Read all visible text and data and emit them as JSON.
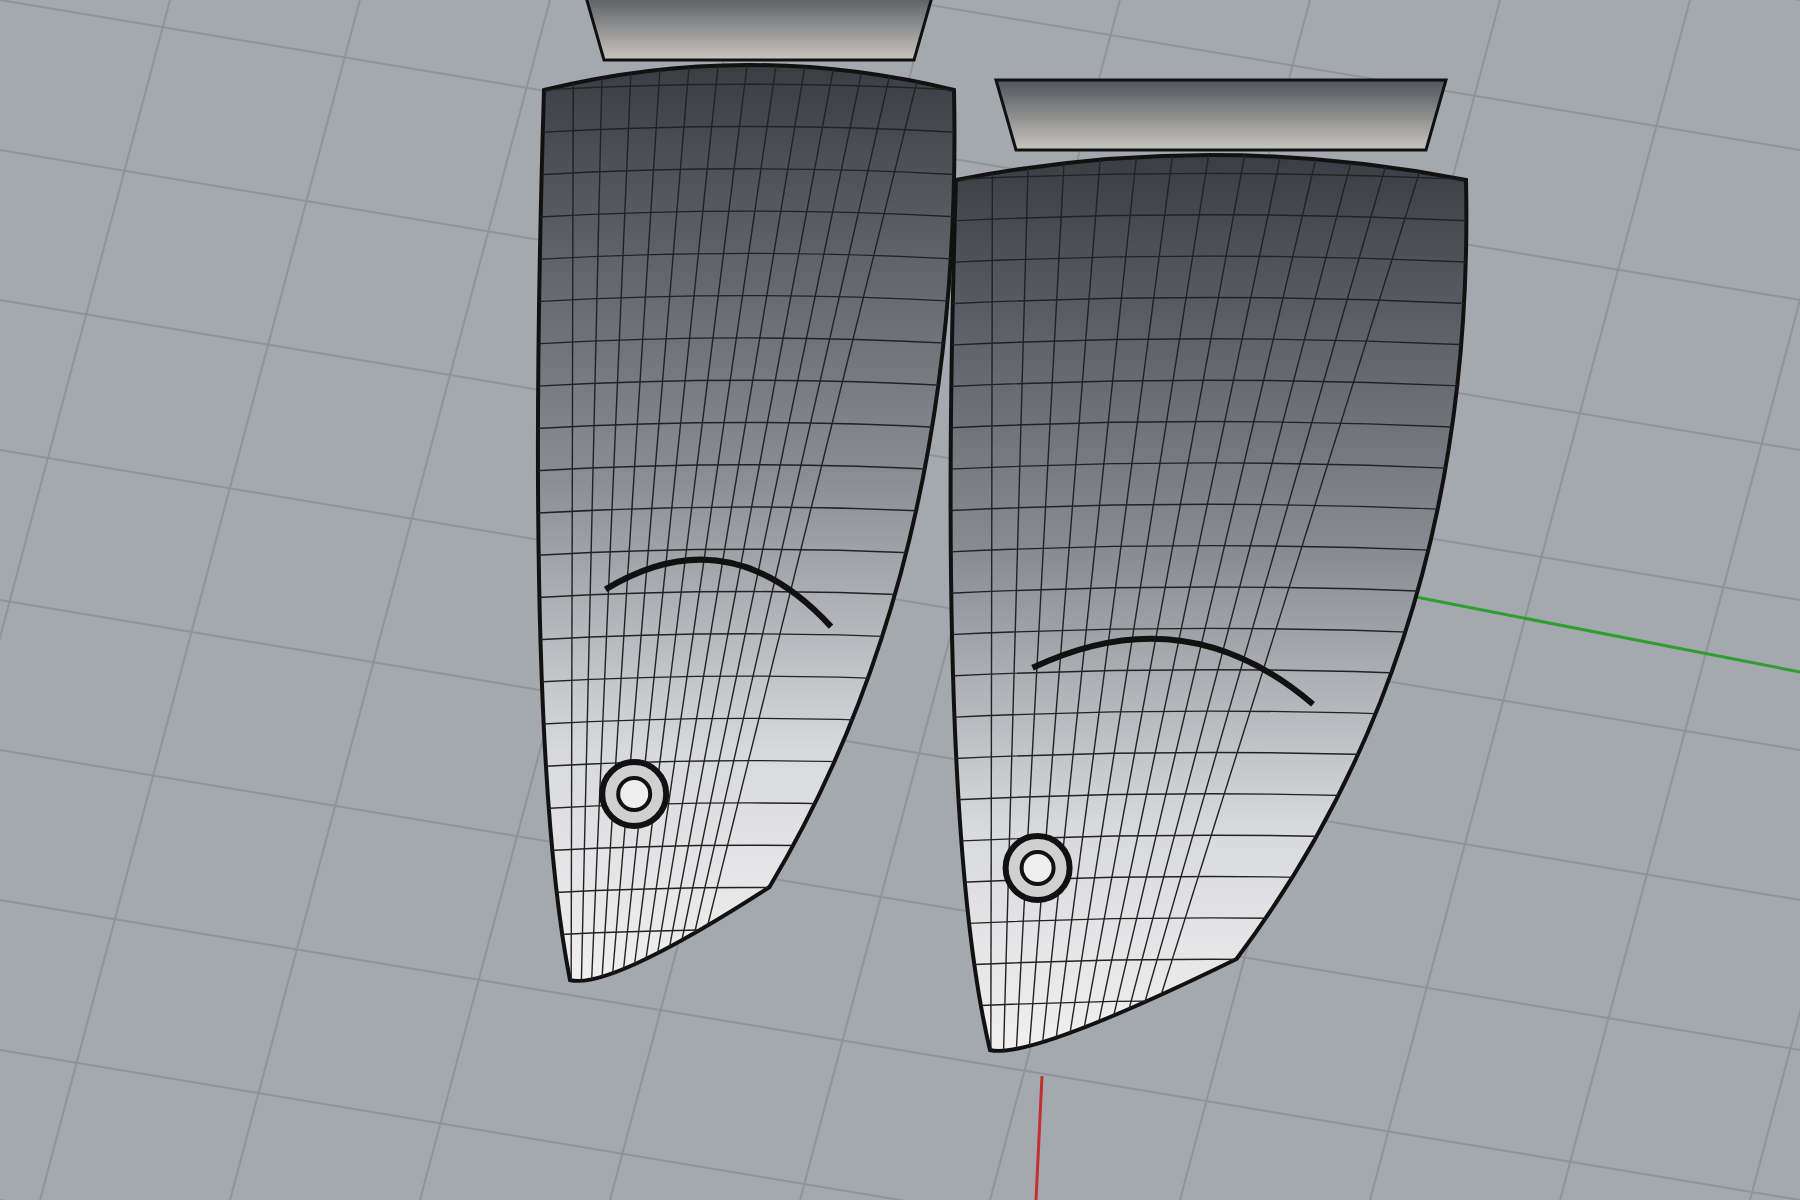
{
  "viewport": {
    "grid_visible": true,
    "axes_visible": true
  }
}
